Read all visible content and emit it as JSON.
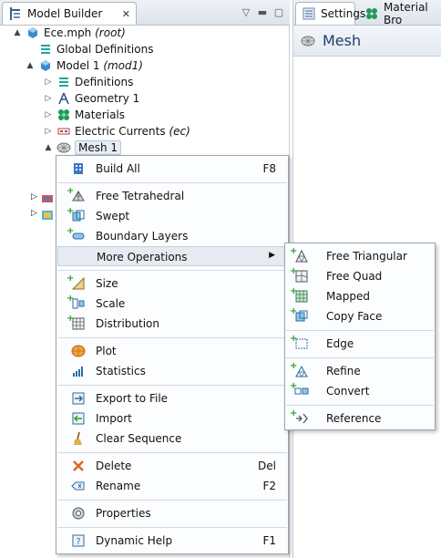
{
  "left_panel": {
    "tab_title": "Model Builder",
    "tree": [
      {
        "label": "Ece.mph",
        "suffix": "(root)",
        "icon": "model-file-icon",
        "twisty": "▲"
      },
      {
        "label": "Global Definitions",
        "suffix": "",
        "icon": "global-definitions-icon",
        "twisty": ""
      },
      {
        "label": "Model 1",
        "suffix": "(mod1)",
        "icon": "model-icon",
        "twisty": "▲"
      },
      {
        "label": "Definitions",
        "suffix": "",
        "icon": "definitions-icon",
        "twisty": "▷"
      },
      {
        "label": "Geometry 1",
        "suffix": "",
        "icon": "geometry-icon",
        "twisty": "▷"
      },
      {
        "label": "Materials",
        "suffix": "",
        "icon": "materials-icon",
        "twisty": "▷"
      },
      {
        "label": "Electric Currents",
        "suffix": "(ec)",
        "icon": "electric-currents-icon",
        "twisty": "▷"
      },
      {
        "label": "Mesh 1",
        "suffix": "",
        "icon": "mesh-icon",
        "twisty": "▲"
      }
    ]
  },
  "right_panel": {
    "tabs": [
      {
        "label": "Settings",
        "icon": "settings-icon"
      },
      {
        "label": "Material Bro",
        "icon": "material-browser-icon"
      }
    ],
    "header_title": "Mesh"
  },
  "context_menu": {
    "items": [
      {
        "label": "Build All",
        "shortcut": "F8",
        "icon": "build-all-icon"
      },
      {
        "label": "Free Tetrahedral",
        "shortcut": "",
        "icon": "free-tetrahedral-icon"
      },
      {
        "label": "Swept",
        "shortcut": "",
        "icon": "swept-icon"
      },
      {
        "label": "Boundary Layers",
        "shortcut": "",
        "icon": "boundary-layers-icon"
      },
      {
        "label": "More Operations",
        "shortcut": "",
        "icon": ""
      },
      {
        "label": "Size",
        "shortcut": "",
        "icon": "size-icon"
      },
      {
        "label": "Scale",
        "shortcut": "",
        "icon": "scale-icon"
      },
      {
        "label": "Distribution",
        "shortcut": "",
        "icon": "distribution-icon"
      },
      {
        "label": "Plot",
        "shortcut": "",
        "icon": "plot-icon"
      },
      {
        "label": "Statistics",
        "shortcut": "",
        "icon": "statistics-icon"
      },
      {
        "label": "Export to File",
        "shortcut": "",
        "icon": "export-icon"
      },
      {
        "label": "Import",
        "shortcut": "",
        "icon": "import-icon"
      },
      {
        "label": "Clear Sequence",
        "shortcut": "",
        "icon": "broom-icon"
      },
      {
        "label": "Delete",
        "shortcut": "Del",
        "icon": "delete-icon"
      },
      {
        "label": "Rename",
        "shortcut": "F2",
        "icon": "rename-icon"
      },
      {
        "label": "Properties",
        "shortcut": "",
        "icon": "properties-icon"
      },
      {
        "label": "Dynamic Help",
        "shortcut": "F1",
        "icon": "dynamic-help-icon"
      }
    ]
  },
  "submenu": {
    "items": [
      {
        "label": "Free Triangular",
        "icon": "free-triangular-icon"
      },
      {
        "label": "Free Quad",
        "icon": "free-quad-icon"
      },
      {
        "label": "Mapped",
        "icon": "mapped-icon"
      },
      {
        "label": "Copy Face",
        "icon": "copy-face-icon"
      },
      {
        "label": "Edge",
        "icon": "edge-icon"
      },
      {
        "label": "Refine",
        "icon": "refine-icon"
      },
      {
        "label": "Convert",
        "icon": "convert-icon"
      },
      {
        "label": "Reference",
        "icon": "reference-icon"
      }
    ]
  },
  "colors": {
    "accent": "#1d3f6b",
    "highlight": "#e6eaf1",
    "plus": "#2aa12a"
  }
}
